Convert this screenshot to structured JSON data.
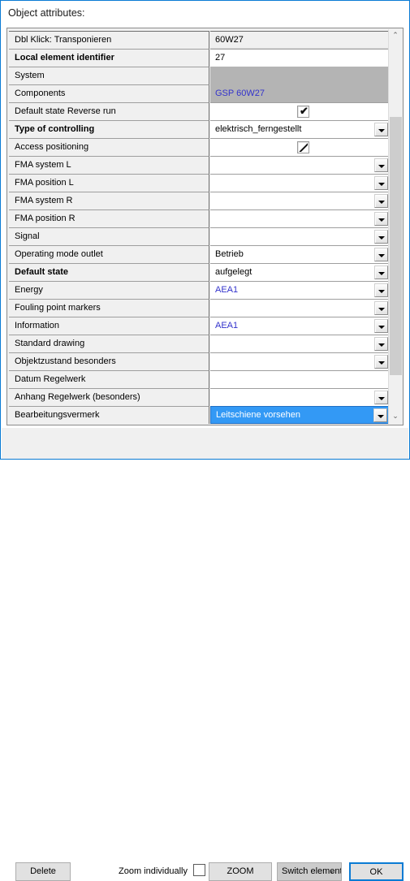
{
  "window": {
    "title": "Object attributes:",
    "border_color": "#0a7bd4",
    "accent_color": "#3399f5",
    "link_color": "#3333cc",
    "disabled_color": "#b4b4b4"
  },
  "grid": {
    "rows": [
      {
        "label": "Dbl Klick: Transponieren",
        "bold": false,
        "value": "60W27",
        "style": "grey",
        "widget": "none"
      },
      {
        "label": "Local element identifier",
        "bold": true,
        "value": "27",
        "style": "white",
        "widget": "none"
      },
      {
        "label": "System",
        "bold": false,
        "value": "",
        "style": "disabled",
        "widget": "none"
      },
      {
        "label": "Components",
        "bold": false,
        "value": "GSP 60W27",
        "style": "disabled link",
        "widget": "none"
      },
      {
        "label": "Default state Reverse run",
        "bold": false,
        "value": "",
        "style": "white",
        "widget": "checkbox-checked"
      },
      {
        "label": "Type of controlling",
        "bold": true,
        "value": "elektrisch_ferngestellt",
        "style": "white",
        "widget": "dropdown"
      },
      {
        "label": "Access positioning",
        "bold": false,
        "value": "",
        "style": "white",
        "widget": "checkbox-slash"
      },
      {
        "label": "FMA system L",
        "bold": false,
        "value": "",
        "style": "white",
        "widget": "dropdown"
      },
      {
        "label": "FMA position L",
        "bold": false,
        "value": "",
        "style": "white",
        "widget": "dropdown"
      },
      {
        "label": "FMA system R",
        "bold": false,
        "value": "",
        "style": "white",
        "widget": "dropdown"
      },
      {
        "label": "FMA position R",
        "bold": false,
        "value": "",
        "style": "white",
        "widget": "dropdown"
      },
      {
        "label": "Signal",
        "bold": false,
        "value": "",
        "style": "white",
        "widget": "dropdown"
      },
      {
        "label": "Operating mode outlet",
        "bold": false,
        "value": "Betrieb",
        "style": "white",
        "widget": "dropdown"
      },
      {
        "label": "Default state",
        "bold": true,
        "value": "aufgelegt",
        "style": "white",
        "widget": "dropdown"
      },
      {
        "label": "Energy",
        "bold": false,
        "value": "AEA1",
        "style": "white link",
        "widget": "dropdown"
      },
      {
        "label": "Fouling point markers",
        "bold": false,
        "value": "",
        "style": "white",
        "widget": "dropdown"
      },
      {
        "label": "Information",
        "bold": false,
        "value": "AEA1",
        "style": "white link",
        "widget": "dropdown"
      },
      {
        "label": "Standard drawing",
        "bold": false,
        "value": "",
        "style": "white",
        "widget": "dropdown"
      },
      {
        "label": "Objektzustand besonders",
        "bold": false,
        "value": "",
        "style": "white",
        "widget": "dropdown"
      },
      {
        "label": "Datum Regelwerk",
        "bold": false,
        "value": "",
        "style": "white",
        "widget": "none"
      },
      {
        "label": "Anhang Regelwerk (besonders)",
        "bold": false,
        "value": "",
        "style": "white",
        "widget": "dropdown"
      },
      {
        "label": "Bearbeitungsvermerk",
        "bold": false,
        "value": "Leitschiene vorsehen",
        "style": "selected",
        "widget": "dropdown"
      }
    ]
  },
  "scrollbar": {
    "up_arrow": "⌃",
    "down_arrow": "⌄"
  },
  "bottom": {
    "delete_label": "Delete",
    "zoom_individually_label": "Zoom individually",
    "zoom_individually_checked": false,
    "zoom_label": "ZOOM",
    "switch_element_label": "Switch element",
    "switch_element_chevron": "⌄",
    "ok_label": "OK"
  }
}
